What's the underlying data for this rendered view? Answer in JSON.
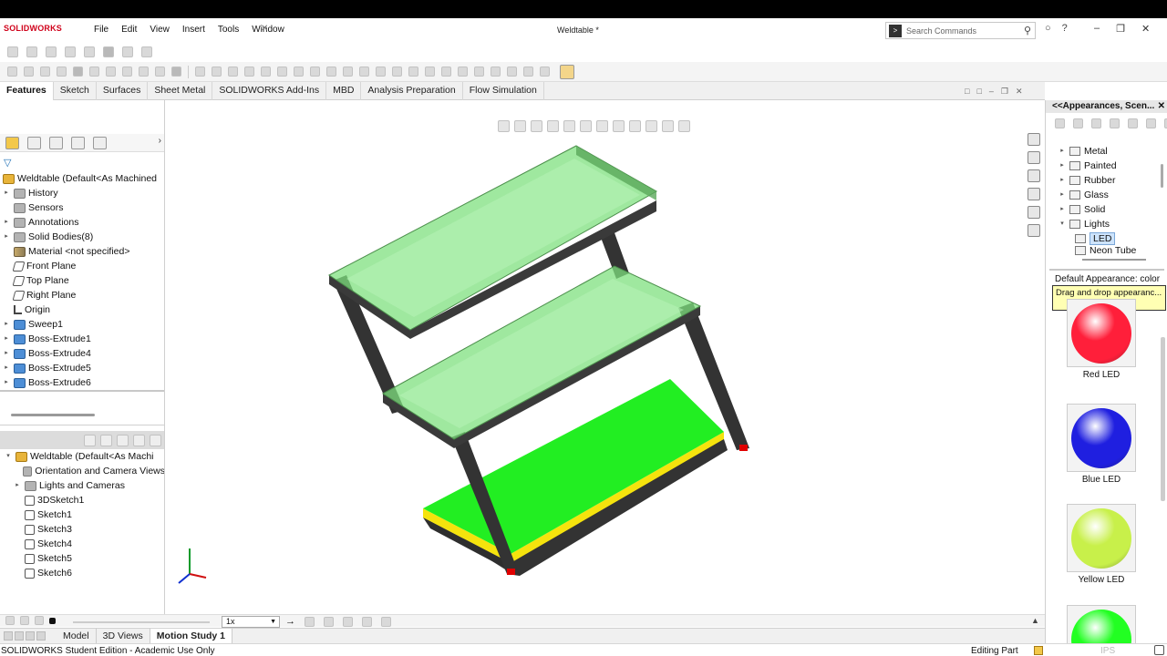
{
  "app": {
    "logo": "SOLIDWORKS",
    "document_title": "Weldtable *",
    "menu": [
      "File",
      "Edit",
      "View",
      "Insert",
      "Tools",
      "Window"
    ]
  },
  "search": {
    "placeholder": "Search Commands"
  },
  "tabs": [
    "Features",
    "Sketch",
    "Surfaces",
    "Sheet Metal",
    "SOLIDWORKS Add-Ins",
    "MBD",
    "Analysis Preparation",
    "Flow Simulation"
  ],
  "feature_tree": {
    "root": "Weldtable  (Default<As Machined",
    "items": [
      {
        "label": "History",
        "icon": "history-icon",
        "expand": true
      },
      {
        "label": "Sensors",
        "icon": "sensors-icon",
        "expand": false
      },
      {
        "label": "Annotations",
        "icon": "annotations-icon",
        "expand": true
      },
      {
        "label": "Solid Bodies(8)",
        "icon": "solid-bodies-icon",
        "expand": true
      },
      {
        "label": "Material <not specified>",
        "icon": "material-icon",
        "expand": false
      },
      {
        "label": "Front Plane",
        "icon": "plane-icon",
        "expand": false
      },
      {
        "label": "Top Plane",
        "icon": "plane-icon",
        "expand": false
      },
      {
        "label": "Right Plane",
        "icon": "plane-icon",
        "expand": false
      },
      {
        "label": "Origin",
        "icon": "origin-icon",
        "expand": false
      },
      {
        "label": "Sweep1",
        "icon": "sweep-icon",
        "expand": true
      },
      {
        "label": "Boss-Extrude1",
        "icon": "extrude-icon",
        "expand": true
      },
      {
        "label": "Boss-Extrude4",
        "icon": "extrude-icon",
        "expand": true
      },
      {
        "label": "Boss-Extrude5",
        "icon": "extrude-icon",
        "expand": true
      },
      {
        "label": "Boss-Extrude6",
        "icon": "extrude-icon",
        "expand": true
      }
    ]
  },
  "display_tree": {
    "root": "Weldtable  (Default<As Machi",
    "items": [
      {
        "label": "Orientation and Camera Views",
        "expand": false
      },
      {
        "label": "Lights and Cameras",
        "expand": true
      },
      {
        "label": "3DSketch1",
        "expand": false
      },
      {
        "label": "Sketch1",
        "expand": false
      },
      {
        "label": "Sketch3",
        "expand": false
      },
      {
        "label": "Sketch4",
        "expand": false
      },
      {
        "label": "Sketch5",
        "expand": false
      },
      {
        "label": "Sketch6",
        "expand": false
      }
    ]
  },
  "appearances": {
    "title": "<<Appearances, Scen...",
    "tree": [
      {
        "label": "Metal"
      },
      {
        "label": "Painted"
      },
      {
        "label": "Rubber"
      },
      {
        "label": "Glass"
      },
      {
        "label": "Solid"
      },
      {
        "label": "Lights"
      }
    ],
    "selected": "LED",
    "next": "Neon Tube",
    "default_label": "Default Appearance: color",
    "tooltip": "Drag and drop appearanc...",
    "swatches": [
      {
        "label": "Red LED",
        "color": "#ff1f3a"
      },
      {
        "label": "Blue LED",
        "color": "#1f1fe0"
      },
      {
        "label": "Yellow LED",
        "color": "#c8f04a"
      },
      {
        "label": "",
        "color": "#22ff22"
      }
    ]
  },
  "motion": {
    "speed": "1x"
  },
  "bottom_tabs": [
    "Model",
    "3D Views",
    "Motion Study 1"
  ],
  "status": {
    "left": "SOLIDWORKS Student Edition - Academic Use Only",
    "mode": "Editing Part",
    "units": "IPS"
  },
  "colors": {
    "frame": "#3a3a3a",
    "glass": "#7fe07f",
    "shelf_green": "#22ee22",
    "accent_yellow": "#f5e30d",
    "foot_red": "#e00000"
  }
}
